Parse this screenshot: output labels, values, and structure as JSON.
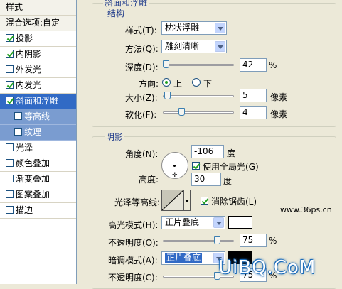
{
  "left_panel": {
    "header": "样式",
    "blend_options": "混合选项:自定",
    "items": [
      {
        "label": "投影",
        "checked": true
      },
      {
        "label": "内阴影",
        "checked": true
      },
      {
        "label": "外发光",
        "checked": false
      },
      {
        "label": "内发光",
        "checked": true
      },
      {
        "label": "斜面和浮雕",
        "checked": true,
        "selected": true
      },
      {
        "label": "等高线",
        "checked": false,
        "sub": true
      },
      {
        "label": "纹理",
        "checked": false,
        "sub": true
      },
      {
        "label": "光泽",
        "checked": false
      },
      {
        "label": "颜色叠加",
        "checked": false
      },
      {
        "label": "渐变叠加",
        "checked": false
      },
      {
        "label": "图案叠加",
        "checked": false
      },
      {
        "label": "描边",
        "checked": false
      }
    ]
  },
  "bevel": {
    "group_title": "斜面和浮雕",
    "structure_title": "结构",
    "style_label": "样式(T):",
    "style_value": "枕状浮雕",
    "technique_label": "方法(Q):",
    "technique_value": "雕刻清晰",
    "depth_label": "深度(D):",
    "depth_value": "42",
    "depth_unit": "%",
    "direction_label": "方向:",
    "direction_up": "上",
    "direction_down": "下",
    "direction_selected": "up",
    "size_label": "大小(Z):",
    "size_value": "5",
    "size_unit": "像素",
    "soften_label": "软化(F):",
    "soften_value": "4",
    "soften_unit": "像素"
  },
  "shading": {
    "title": "阴影",
    "angle_label": "角度(N):",
    "angle_value": "-106",
    "angle_unit": "度",
    "global_light_label": "使用全局光(G)",
    "global_light_checked": true,
    "altitude_label": "高度:",
    "altitude_value": "30",
    "altitude_unit": "度",
    "gloss_label": "光泽等高线:",
    "antialias_label": "消除锯齿(L)",
    "antialias_checked": true,
    "highlight_mode_label": "高光模式(H):",
    "highlight_mode_value": "正片叠底",
    "highlight_color": "#ffffff",
    "highlight_opacity_label": "不透明度(O):",
    "highlight_opacity_value": "75",
    "percent": "%",
    "shadow_mode_label": "暗调模式(A):",
    "shadow_mode_value": "正片叠底",
    "shadow_color": "#000000",
    "shadow_opacity_label": "不透明度(C):",
    "shadow_opacity_value": "75"
  },
  "watermarks": {
    "site": "www.36ps.cn",
    "brand": "UiBQ.CoM"
  }
}
